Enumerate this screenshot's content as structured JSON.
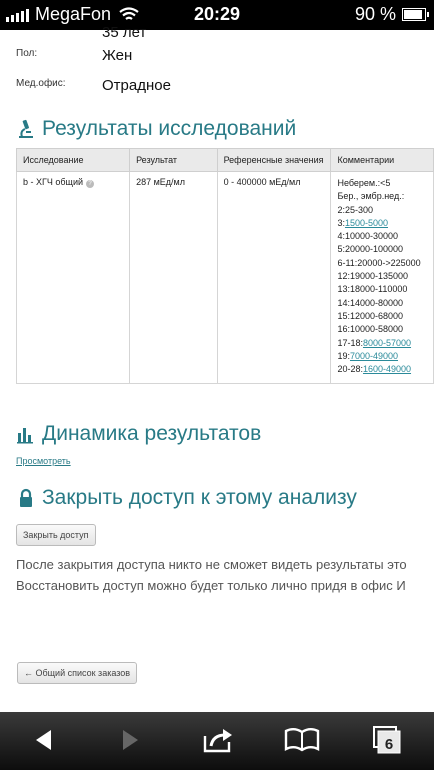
{
  "status": {
    "carrier": "MegaFon",
    "time": "20:29",
    "battery": "90 %",
    "battery_level": 0.9
  },
  "info": {
    "age_partial": "35 лет",
    "gender_label": "Пол:",
    "gender_value": "Жен",
    "office_label": "Мед.офис:",
    "office_value": "Отрадное"
  },
  "results": {
    "title": "Результаты исследований",
    "headers": [
      "Исследование",
      "Результат",
      "Референсные значения",
      "Комментарии"
    ],
    "row": {
      "test": "b - ХГЧ общий",
      "result": "287 мЕд/мл",
      "reference": "0 - 400000 мЕд/мл",
      "comments": [
        {
          "text": "Неберем.:<5"
        },
        {
          "text": "Бер., эмбр.нед.:"
        },
        {
          "text": "2:25-300"
        },
        {
          "text": "3:",
          "link": "1500-5000"
        },
        {
          "text": "4:10000-30000"
        },
        {
          "text": "5:20000-100000"
        },
        {
          "text": "6-11:20000->225000"
        },
        {
          "text": "12:19000-135000"
        },
        {
          "text": "13:18000-110000"
        },
        {
          "text": "14:14000-80000"
        },
        {
          "text": "15:12000-68000"
        },
        {
          "text": "16:10000-58000"
        },
        {
          "text": "17-18:",
          "link": "8000-57000"
        },
        {
          "text": "19:",
          "link": "7000-49000"
        },
        {
          "text": "20-28:",
          "link": "1600-49000"
        }
      ]
    }
  },
  "dynamics": {
    "title": "Динамика результатов",
    "view_link": "Просмотреть"
  },
  "close_access": {
    "title": "Закрыть доступ к этому анализу",
    "button": "Закрыть доступ",
    "line1": "После закрытия доступа никто не сможет видеть результаты это",
    "line2": "Восстановить доступ можно будет только лично придя в офис И"
  },
  "back_button": "← Общий список заказов",
  "toolbar": {
    "tabs_count": "6"
  }
}
